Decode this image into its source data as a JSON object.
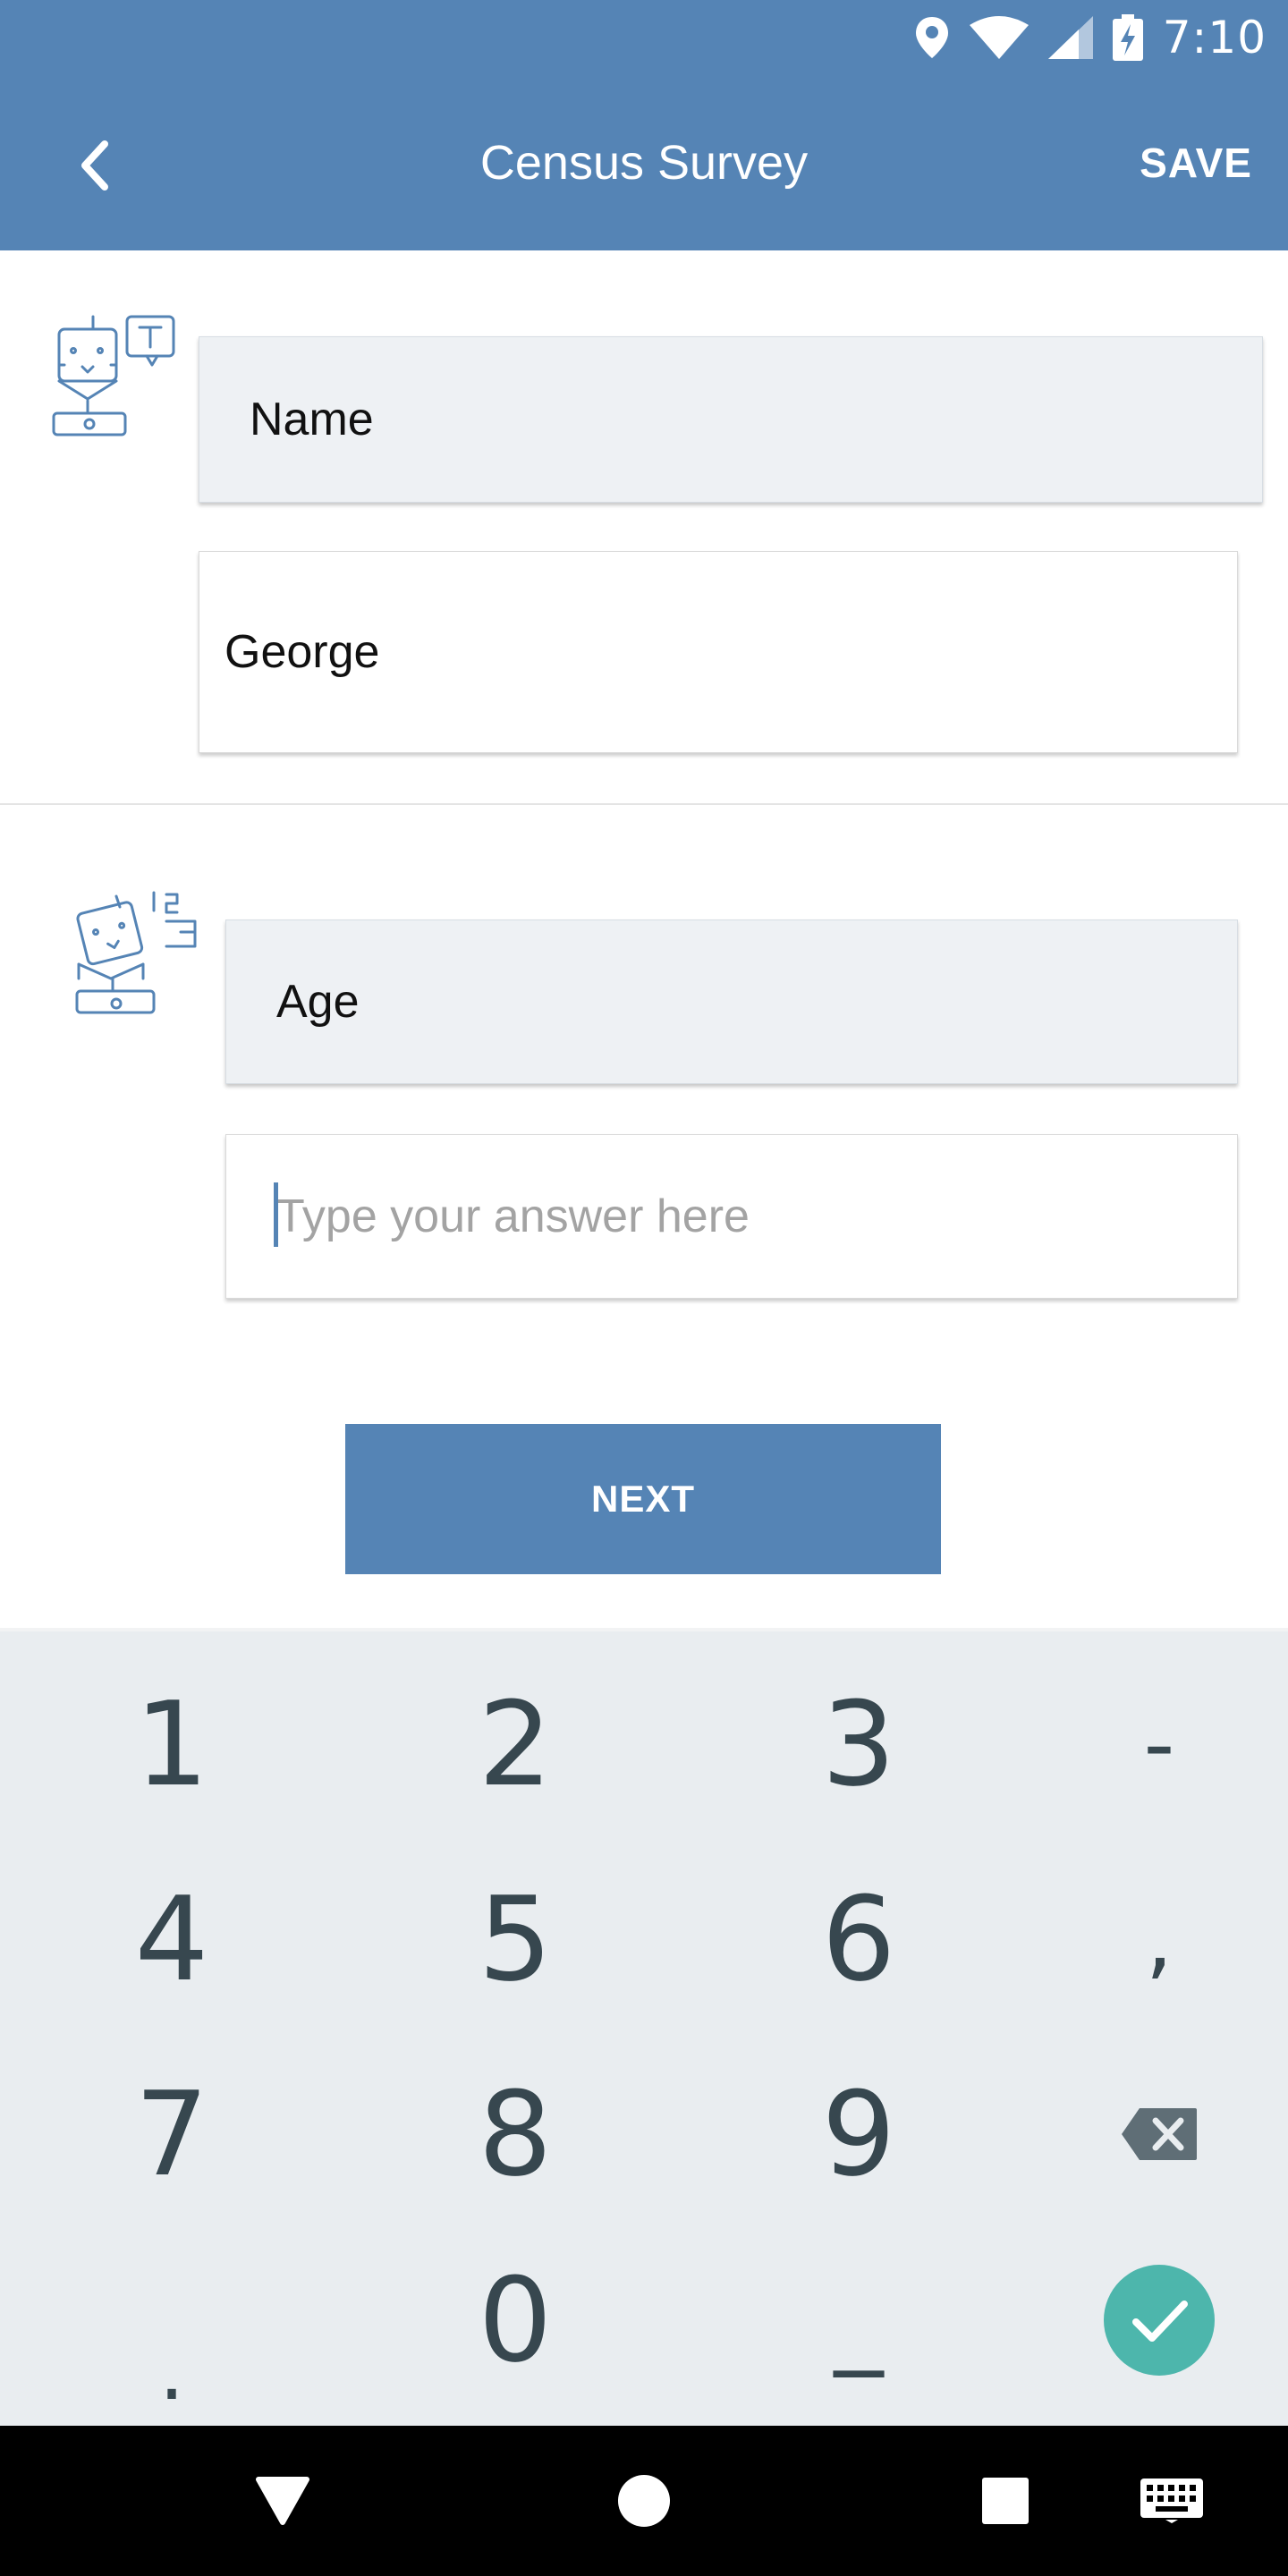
{
  "colors": {
    "primary": "#5584b5",
    "keyboard_bg": "#e9edf0",
    "key_text": "#37474f",
    "confirm": "#4db6ac",
    "question_bg": "#eef1f4"
  },
  "status_bar": {
    "time": "7:10",
    "icons": [
      "location-icon",
      "wifi-icon",
      "signal-icon",
      "battery-charging-icon"
    ]
  },
  "app_bar": {
    "title": "Census Survey",
    "save_label": "SAVE",
    "back_icon": "chevron-left-icon"
  },
  "survey": {
    "questions": [
      {
        "prompt": "Name",
        "answer": "George",
        "bot_icon": "bot-text-icon"
      },
      {
        "prompt": "Age",
        "placeholder": "Type your answer here",
        "bot_icon": "bot-numbers-icon"
      }
    ],
    "next_label": "NEXT"
  },
  "keyboard": {
    "rows": [
      [
        "1",
        "2",
        "3",
        "-"
      ],
      [
        "4",
        "5",
        "6",
        ","
      ],
      [
        "7",
        "8",
        "9",
        "backspace-icon"
      ],
      [
        ".",
        "0",
        "_",
        "check-icon"
      ]
    ]
  },
  "nav_bar": {
    "icons": [
      "back-triangle-icon",
      "home-circle-icon",
      "recents-square-icon",
      "keyboard-icon"
    ]
  }
}
